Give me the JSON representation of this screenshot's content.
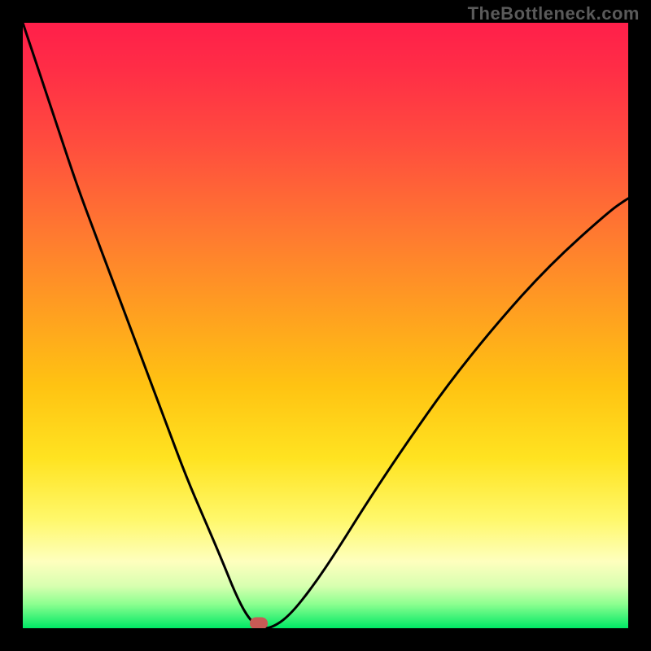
{
  "watermark": "TheBottleneck.com",
  "colors": {
    "top": "#ff1f4a",
    "mid": "#ffd400",
    "bottom": "#00e865",
    "curve": "#000000",
    "marker": "#c85a55"
  },
  "chart_data": {
    "type": "line",
    "title": "",
    "xlabel": "",
    "ylabel": "",
    "xlim": [
      0,
      100
    ],
    "ylim": [
      0,
      100
    ],
    "grid": false,
    "legend": false,
    "min_marker_x": 39,
    "series": [
      {
        "name": "bottleneck-percent",
        "x": [
          0,
          3,
          6,
          9,
          12,
          15,
          18,
          21,
          24,
          27,
          30,
          33,
          35,
          37,
          39,
          41,
          44,
          48,
          52,
          57,
          63,
          70,
          78,
          87,
          97,
          100
        ],
        "y": [
          100,
          91,
          82,
          73,
          65,
          57,
          49,
          41,
          33,
          25,
          18,
          11,
          6,
          2,
          0,
          0,
          2,
          7,
          13,
          21,
          30,
          40,
          50,
          60,
          69,
          71
        ]
      }
    ]
  }
}
